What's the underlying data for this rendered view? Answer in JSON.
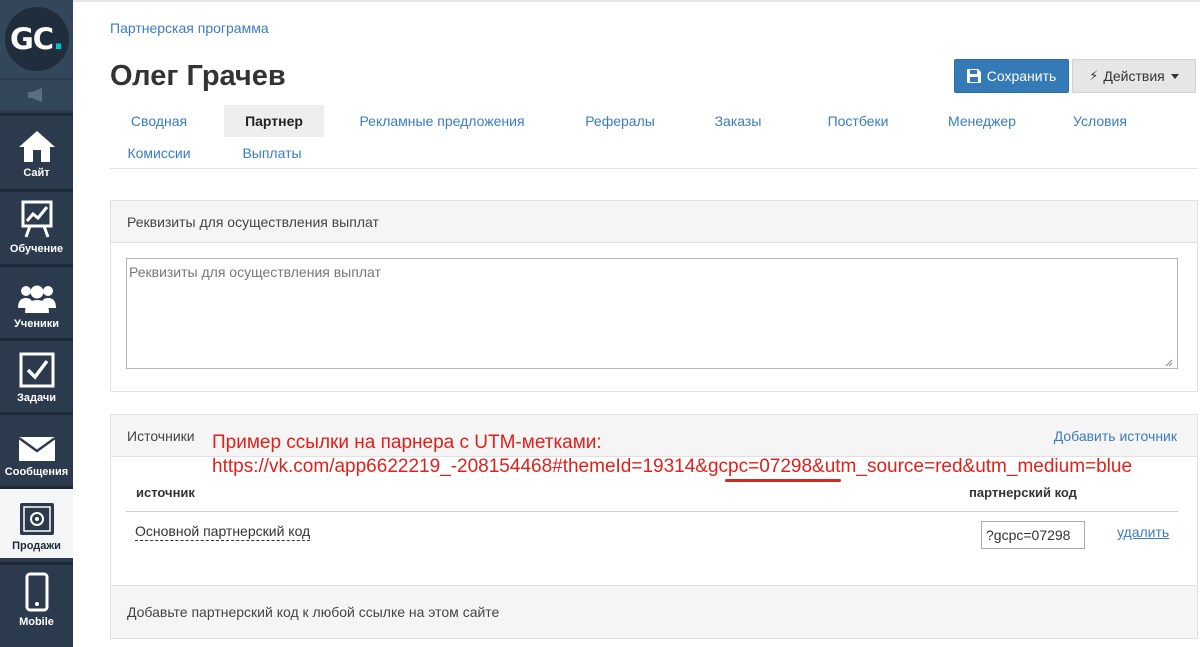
{
  "sidebar": {
    "logo": {
      "text": "GC",
      "dot": "."
    },
    "items": [
      {
        "id": "site",
        "label": "Сайт",
        "icon": "home-icon"
      },
      {
        "id": "learning",
        "label": "Обучение",
        "icon": "chart-board-icon"
      },
      {
        "id": "students",
        "label": "Ученики",
        "icon": "users-icon"
      },
      {
        "id": "tasks",
        "label": "Задачи",
        "icon": "checkbox-icon"
      },
      {
        "id": "messages",
        "label": "Сообщения",
        "icon": "envelope-icon"
      },
      {
        "id": "sales",
        "label": "Продажи",
        "icon": "safe-icon",
        "active": true
      },
      {
        "id": "mobile",
        "label": "Mobile",
        "icon": "phone-icon"
      }
    ]
  },
  "header": {
    "breadcrumb": "Партнерская программа",
    "title": "Олег Грачев",
    "save_label": "Сохранить",
    "actions_label": "Действия"
  },
  "tabs": [
    {
      "label": "Сводная"
    },
    {
      "label": "Партнер",
      "active": true
    },
    {
      "label": "Рекламные предложения"
    },
    {
      "label": "Рефералы"
    },
    {
      "label": "Заказы"
    },
    {
      "label": "Постбеки"
    },
    {
      "label": "Менеджер"
    },
    {
      "label": "Условия"
    },
    {
      "label": "Комиссии"
    },
    {
      "label": "Выплаты"
    }
  ],
  "payout_panel": {
    "heading": "Реквизиты для осуществления выплат",
    "textarea_placeholder": "Реквизиты для осуществления выплат",
    "textarea_value": ""
  },
  "sources_panel": {
    "heading": "Источники",
    "add_link": "Добавить источник",
    "annotation": {
      "line1": "Пример ссылки на парнера с UTM-метками:",
      "line2": "https://vk.com/app6622219_-208154468#themeId=19314&gcpc=07298&utm_source=red&utm_medium=blue",
      "color": "#e0201b"
    },
    "columns": {
      "source": "источник",
      "code": "партнерский код"
    },
    "rows": [
      {
        "source": "Основной партнерский код",
        "code": "?gcpc=07298",
        "delete_label": "удалить"
      }
    ],
    "footer": "Добавьте партнерский код к любой ссылке на этом сайте"
  },
  "colors": {
    "sidebar": "#2b3a4c",
    "accent": "#337ab7",
    "link": "#3a7cc1",
    "logo_dot": "#00c3cf"
  }
}
